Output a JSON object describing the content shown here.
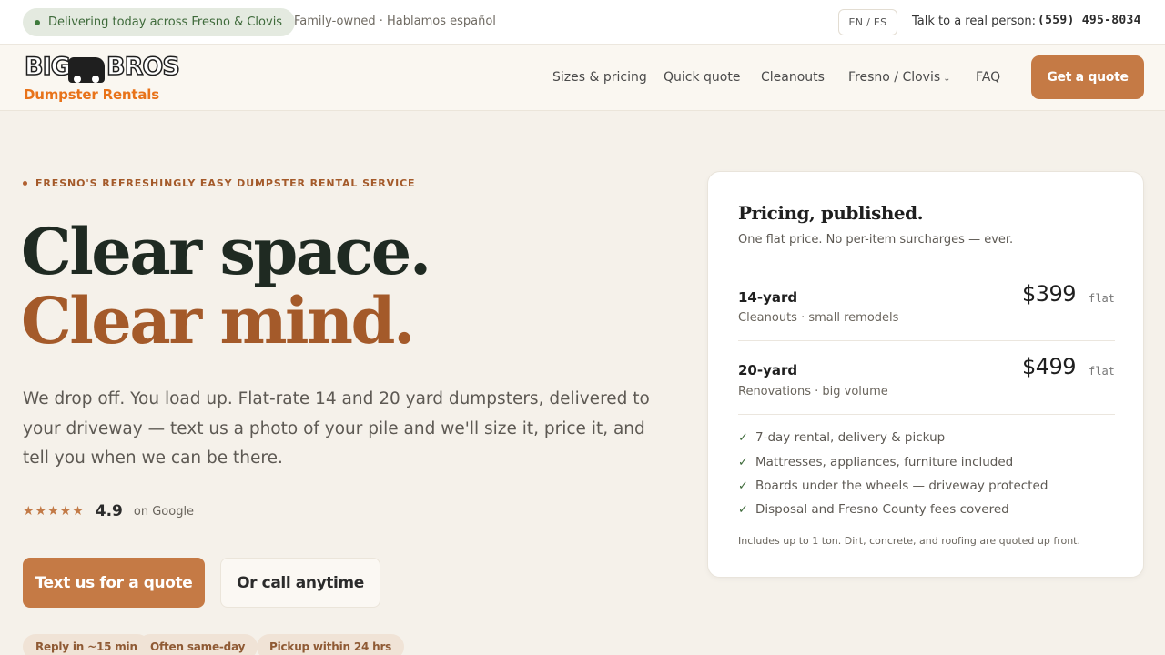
{
  "topbar": {
    "delivery": "Delivering today across Fresno & Clovis",
    "tagline": "Family-owned · Hablamos español",
    "lang_toggle": "EN / ES",
    "talk_label": "Talk to a real person:",
    "phone": "(559) 495-8034"
  },
  "logo": {
    "word1": "BIG",
    "word2": "BROS",
    "subtitle": "Dumpster Rentals"
  },
  "nav": {
    "items": [
      {
        "label": "Sizes & pricing"
      },
      {
        "label": "Quick quote"
      },
      {
        "label": "Cleanouts"
      },
      {
        "label": "Fresno / Clovis"
      },
      {
        "label": "FAQ"
      }
    ],
    "cta": "Get a quote"
  },
  "hero": {
    "eyebrow": "FRESNO'S REFRESHINGLY EASY DUMPSTER RENTAL SERVICE",
    "headline_1": "Clear space.",
    "headline_2": "Clear mind.",
    "lede": "We drop off. You load up. Flat-rate 14 and 20 yard dumpsters, delivered to your driveway — text us a photo of your pile and we'll size it, price it, and tell you when we can be there.",
    "stars": "★★★★★",
    "rating": "4.9",
    "rating_source": "on Google",
    "primary_cta": "Text us for a quote",
    "secondary_cta": "Or call anytime",
    "chips": [
      "Reply in ~15 min",
      "Often same-day",
      "Pickup within 24 hrs"
    ]
  },
  "pricing": {
    "title": "Pricing, published.",
    "subtitle": "One flat price. No per-item surcharges — ever.",
    "tiers": [
      {
        "name": "14-yard",
        "desc": "Cleanouts · small remodels",
        "price": "$399",
        "unit": "flat"
      },
      {
        "name": "20-yard",
        "desc": "Renovations · big volume",
        "price": "$499",
        "unit": "flat"
      }
    ],
    "features": [
      "7-day rental, delivery & pickup",
      "Mattresses, appliances, furniture included",
      "Boards under the wheels — driveway protected",
      "Disposal and Fresno County fees covered"
    ],
    "note": "Includes up to 1 ton. Dirt, concrete, and roofing are quoted up front."
  },
  "colors": {
    "accent": "#c57a45",
    "headline_dark": "#1f2a22",
    "headline_accent": "#a45a2a",
    "delivery_green": "#3e6a3a"
  }
}
